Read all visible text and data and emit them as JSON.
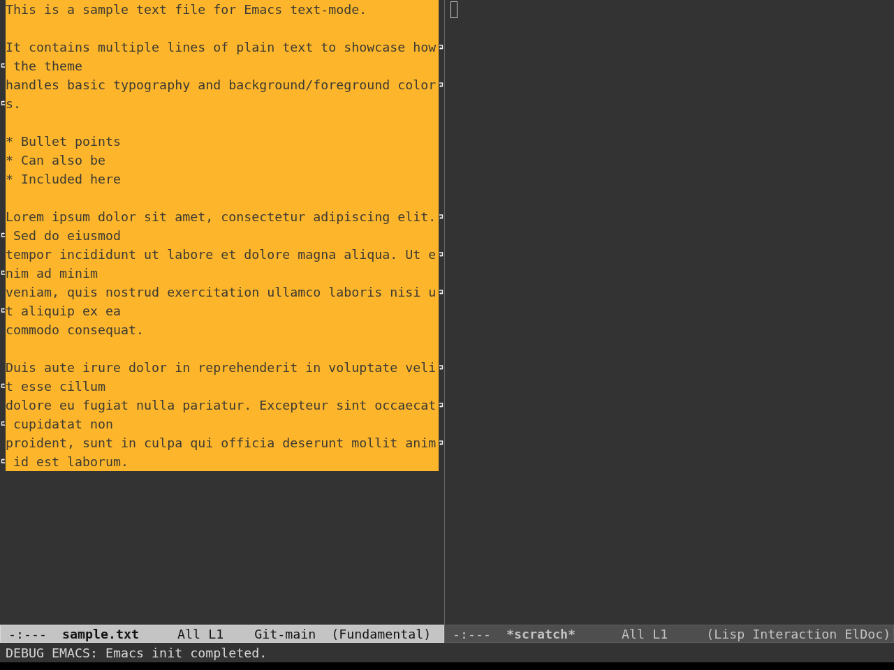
{
  "windows": [
    {
      "buffer": {
        "region_active": true,
        "paragraphs": [
          {
            "lines": [
              {
                "rows": [
                  "This is a sample text file for Emacs text-mode."
                ]
              }
            ]
          },
          {
            "lines": [
              {
                "rows": [
                  "It contains multiple lines of plain text to showcase how",
                  " the theme"
                ]
              },
              {
                "rows": [
                  "handles basic typography and background/foreground color",
                  "s."
                ]
              }
            ]
          },
          {
            "lines": [
              {
                "rows": [
                  "* Bullet points"
                ]
              },
              {
                "rows": [
                  "* Can also be"
                ]
              },
              {
                "rows": [
                  "* Included here"
                ]
              }
            ]
          },
          {
            "lines": [
              {
                "rows": [
                  "Lorem ipsum dolor sit amet, consectetur adipiscing elit.",
                  " Sed do eiusmod"
                ]
              },
              {
                "rows": [
                  "tempor incididunt ut labore et dolore magna aliqua. Ut e",
                  "nim ad minim"
                ]
              },
              {
                "rows": [
                  "veniam, quis nostrud exercitation ullamco laboris nisi u",
                  "t aliquip ex ea"
                ]
              },
              {
                "rows": [
                  "commodo consequat."
                ]
              }
            ]
          },
          {
            "lines": [
              {
                "rows": [
                  "Duis aute irure dolor in reprehenderit in voluptate veli",
                  "t esse cillum"
                ]
              },
              {
                "rows": [
                  "dolore eu fugiat nulla pariatur. Excepteur sint occaecat",
                  " cupidatat non"
                ]
              },
              {
                "rows": [
                  "proident, sunt in culpa qui officia deserunt mollit anim",
                  " id est laborum."
                ]
              }
            ]
          }
        ]
      },
      "mode_line": {
        "active": true,
        "flags": "-:---",
        "buffer_name": "sample.txt",
        "position": "All L1",
        "vc_branch": "Git-main",
        "major_mode": "(Fundamental)"
      }
    },
    {
      "cursor": {
        "kind": "hollow"
      },
      "mode_line": {
        "active": false,
        "flags": "-:---",
        "buffer_name": "*scratch*",
        "position": "All L1",
        "major_mode": "(Lisp Interaction ElDoc)"
      }
    }
  ],
  "echo_area": {
    "message": "DEBUG EMACS: Emacs init completed."
  }
}
